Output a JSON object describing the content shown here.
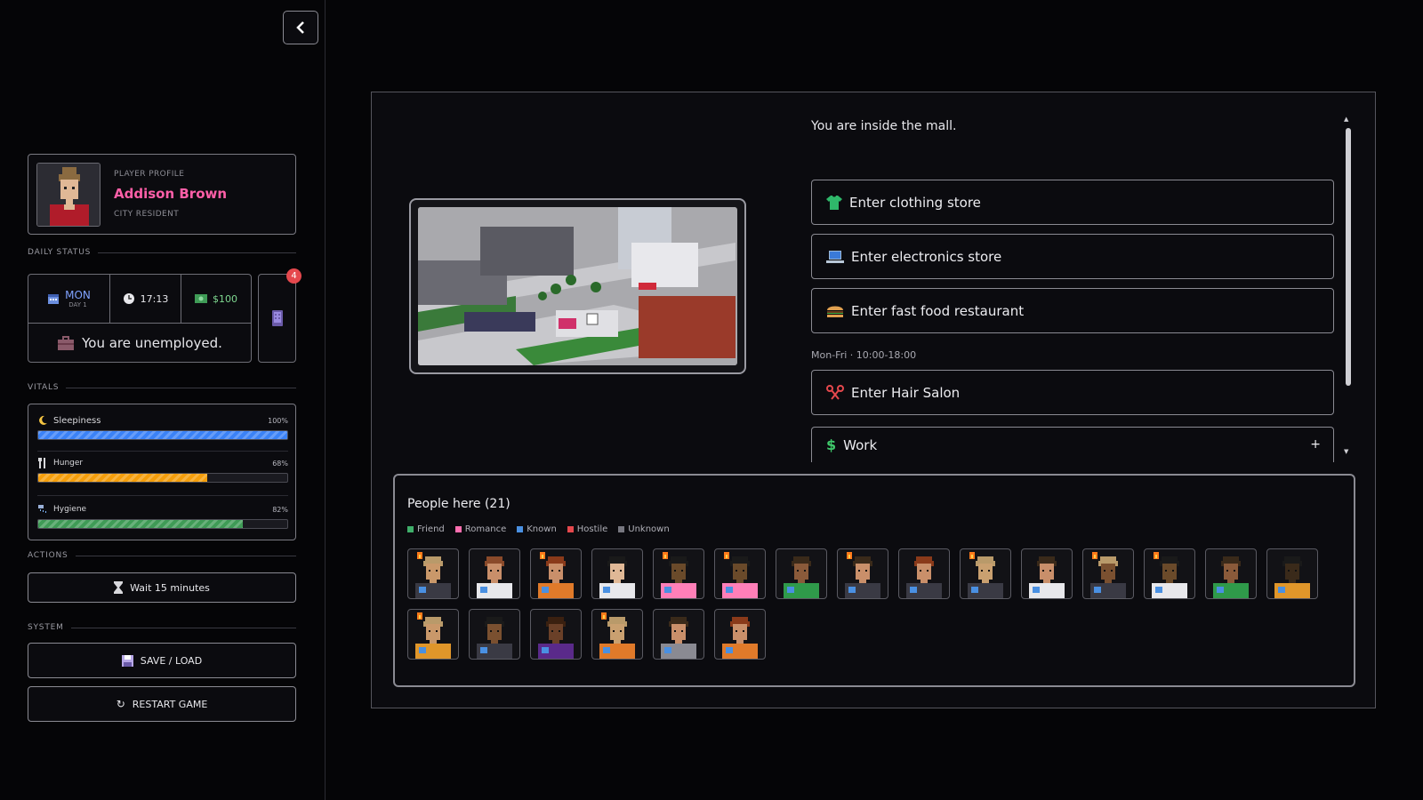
{
  "player": {
    "kicker": "PLAYER PROFILE",
    "name": "Addison Brown",
    "role": "CITY RESIDENT"
  },
  "sections": {
    "daily_status": "DAILY STATUS",
    "vitals": "VITALS",
    "actions": "ACTIONS",
    "system": "SYSTEM"
  },
  "status": {
    "day": "MON",
    "day_sub": "DAY 1",
    "time": "17:13",
    "money": "$100",
    "employment": "You are unemployed.",
    "notifications": "4"
  },
  "vitals": [
    {
      "label": "Sleepiness",
      "percent_text": "100%",
      "level": 1.0,
      "color": "#3b82f6",
      "icon": "moon-icon"
    },
    {
      "label": "Hunger",
      "percent_text": "68%",
      "level": 0.68,
      "color": "#f59e0b",
      "icon": "fork-knife-icon"
    },
    {
      "label": "Hygiene",
      "percent_text": "82%",
      "level": 0.82,
      "color": "#3f9b56",
      "icon": "shower-icon"
    }
  ],
  "actions": {
    "wait": "Wait 15 minutes"
  },
  "system": {
    "save": "SAVE / LOAD",
    "restart": "RESTART GAME"
  },
  "location": {
    "text": "You are inside the mall.",
    "options": [
      {
        "label": "Enter clothing store",
        "icon": "shirt-icon"
      },
      {
        "label": "Enter electronics store",
        "icon": "laptop-icon"
      },
      {
        "label": "Enter fast food restaurant",
        "icon": "burger-icon"
      }
    ],
    "hours": "Mon-Fri · 10:00-18:00",
    "salon": {
      "label": "Enter Hair Salon",
      "icon": "scissors-icon"
    },
    "work": {
      "label": "Work",
      "icon": "dollar-icon",
      "expand": "+"
    }
  },
  "people": {
    "title": "People here (21)",
    "legend": [
      {
        "label": "Friend",
        "color": "#3fae6a"
      },
      {
        "label": "Romance",
        "color": "#ff6fb0"
      },
      {
        "label": "Known",
        "color": "#4a90e2"
      },
      {
        "label": "Hostile",
        "color": "#e5484d"
      },
      {
        "label": "Unknown",
        "color": "#777780"
      }
    ],
    "avatars": [
      {
        "skin": "#c9986a",
        "hair": "#b99a6a",
        "shirt": "#3a3a44",
        "fire": true
      },
      {
        "skin": "#c98f6a",
        "hair": "#8a4a2a",
        "shirt": "#e8e8ec",
        "fire": false
      },
      {
        "skin": "#c98f6a",
        "hair": "#8a3a1a",
        "shirt": "#e07a2a",
        "fire": true
      },
      {
        "skin": "#e0b896",
        "hair": "#1a1a1a",
        "shirt": "#e8e8ec",
        "fire": false
      },
      {
        "skin": "#6a4a2a",
        "hair": "#1a1a1a",
        "shirt": "#ff7fb8",
        "fire": true
      },
      {
        "skin": "#6a4a2a",
        "hair": "#1a1a1a",
        "shirt": "#ff7fb8",
        "fire": true
      },
      {
        "skin": "#8a5a3a",
        "hair": "#3a2a1a",
        "shirt": "#2f9a4a",
        "fire": false
      },
      {
        "skin": "#c98f6a",
        "hair": "#3a2a1a",
        "shirt": "#3a3a44",
        "fire": true
      },
      {
        "skin": "#c98f6a",
        "hair": "#8a3a1a",
        "shirt": "#3a3a44",
        "fire": false
      },
      {
        "skin": "#c9a070",
        "hair": "#b99a6a",
        "shirt": "#3a3a44",
        "fire": true
      },
      {
        "skin": "#c98f6a",
        "hair": "#3a2a1a",
        "shirt": "#e8e8ec",
        "fire": false
      },
      {
        "skin": "#7a5030",
        "hair": "#b99a6a",
        "shirt": "#3a3a44",
        "fire": true
      },
      {
        "skin": "#6a4a2a",
        "hair": "#1a1a1a",
        "shirt": "#e8e8ec",
        "fire": true
      },
      {
        "skin": "#8a5a3a",
        "hair": "#3a2a1a",
        "shirt": "#2f9a4a",
        "fire": false
      },
      {
        "skin": "#3a2a1a",
        "hair": "#1a1a1a",
        "shirt": "#e0962a",
        "fire": false
      },
      {
        "skin": "#c9986a",
        "hair": "#b99a6a",
        "shirt": "#e0962a",
        "fire": true
      },
      {
        "skin": "#7a5030",
        "hair": "#1a1a1a",
        "shirt": "#3a3a44",
        "fire": false
      },
      {
        "skin": "#6a4028",
        "hair": "#3a2010",
        "shirt": "#5a2a8a",
        "fire": false
      },
      {
        "skin": "#c9a070",
        "hair": "#b99a6a",
        "shirt": "#e07a2a",
        "fire": true
      },
      {
        "skin": "#c98f6a",
        "hair": "#3a2a1a",
        "shirt": "#8a8a92",
        "fire": false
      },
      {
        "skin": "#c98f6a",
        "hair": "#8a3a1a",
        "shirt": "#e07a2a",
        "fire": false
      }
    ]
  }
}
